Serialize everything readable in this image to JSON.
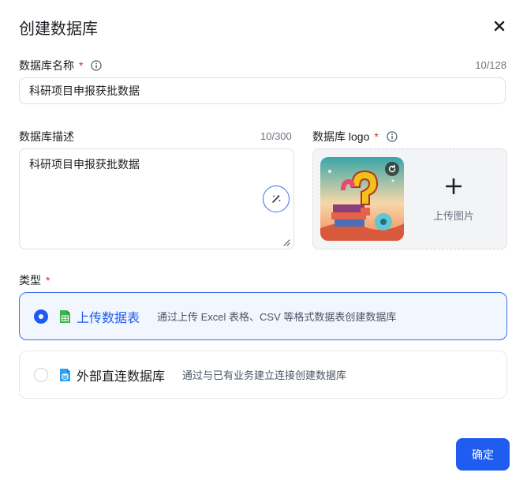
{
  "dialog": {
    "title": "创建数据库",
    "close_icon": "close-icon"
  },
  "name_field": {
    "label": "数据库名称",
    "required": "*",
    "counter": "10/128",
    "value": "科研项目申报获批数据"
  },
  "desc_field": {
    "label": "数据库描述",
    "counter": "10/300",
    "value": "科研项目申报获批数据"
  },
  "logo_field": {
    "label": "数据库 logo",
    "required": "*",
    "upload_text": "上传图片",
    "upload_icon": "plus-icon"
  },
  "type_field": {
    "label": "类型",
    "required": "*",
    "options": [
      {
        "title": "上传数据表",
        "description": "通过上传 Excel 表格、CSV 等格式数据表创建数据库",
        "checked": true,
        "icon": "spreadsheet-icon",
        "icon_color": "#3bb54a"
      },
      {
        "title": "外部直连数据库",
        "description": "通过与已有业务建立连接创建数据库",
        "checked": false,
        "icon": "database-file-icon",
        "icon_color": "#2ea0f0"
      }
    ]
  },
  "footer": {
    "confirm_label": "确定"
  },
  "colors": {
    "primary": "#1f5cf0",
    "required": "#d92d20"
  }
}
